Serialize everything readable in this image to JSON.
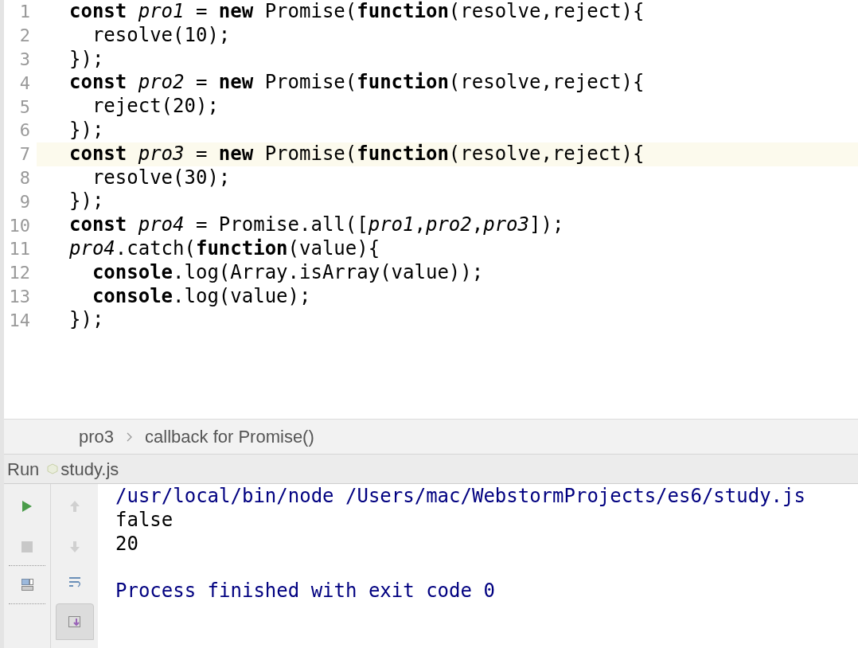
{
  "editor": {
    "lines": [
      {
        "number": "1",
        "current": false,
        "text": "**const** *pro1* = **new** Promise(**function**(resolve,reject){"
      },
      {
        "number": "2",
        "current": false,
        "text": "  resolve(10);"
      },
      {
        "number": "3",
        "current": false,
        "text": "});"
      },
      {
        "number": "4",
        "current": false,
        "text": "**const** *pro2* = **new** Promise(**function**(resolve,reject){"
      },
      {
        "number": "5",
        "current": false,
        "text": "  reject(20);"
      },
      {
        "number": "6",
        "current": false,
        "text": "});"
      },
      {
        "number": "7",
        "current": true,
        "text": "**const** *pro3* = **new** Promise(**function**(resolve,reject){"
      },
      {
        "number": "8",
        "current": false,
        "text": "  resolve(30);"
      },
      {
        "number": "9",
        "current": false,
        "text": "});"
      },
      {
        "number": "10",
        "current": false,
        "text": "**const** *pro4* = Promise.all([*pro1*,*pro2*,*pro3*]);"
      },
      {
        "number": "11",
        "current": false,
        "text": "*pro4*.catch(**function**(value){"
      },
      {
        "number": "12",
        "current": false,
        "text": "  **console**.log(Array.isArray(value));"
      },
      {
        "number": "13",
        "current": false,
        "text": "  **console**.log(value);"
      },
      {
        "number": "14",
        "current": false,
        "text": "});"
      }
    ]
  },
  "breadcrumbs": [
    {
      "label": "pro3"
    },
    {
      "label": "callback for Promise()"
    }
  ],
  "run_panel": {
    "title": "Run",
    "file": "study.js",
    "scroll_to_end_pressed": true,
    "output": [
      {
        "kind": "system",
        "text": "/usr/local/bin/node /Users/mac/WebstormProjects/es6/study.js"
      },
      {
        "kind": "stdout",
        "text": "false"
      },
      {
        "kind": "stdout",
        "text": "20"
      },
      {
        "kind": "exit",
        "text": "Process finished with exit code 0"
      }
    ]
  }
}
